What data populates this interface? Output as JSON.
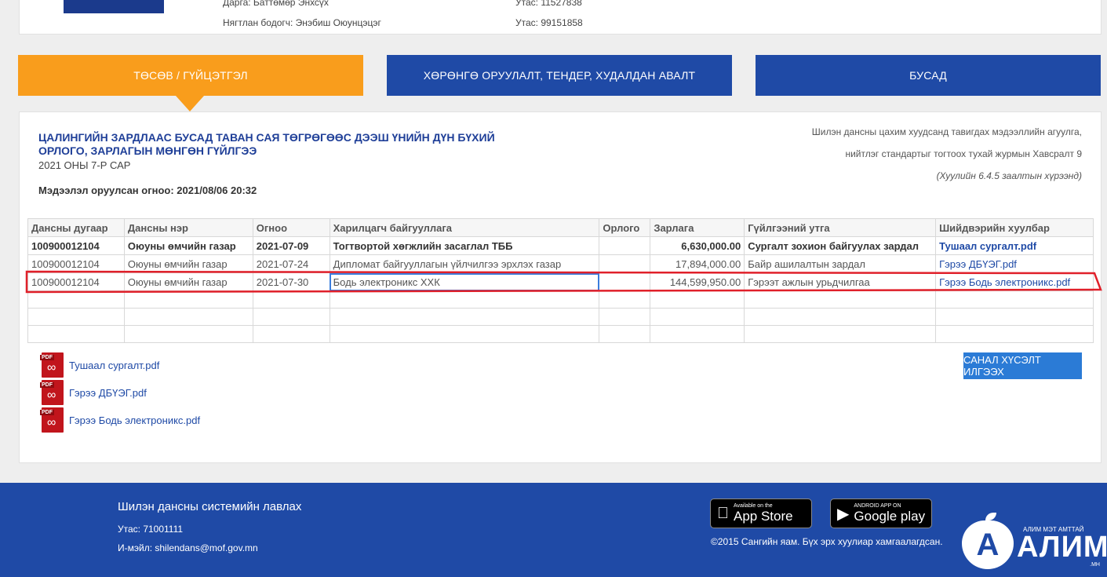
{
  "top_info": {
    "director": "Дарга: Баттөмөр Энхсүх",
    "director_phone": "Утас: 11527838",
    "accountant": "Нягтлан бодогч: Энэбиш Оюунцэцэг",
    "accountant_phone": "Утас: 99151858"
  },
  "tabs": [
    {
      "label": "ТӨСӨВ / ГҮЙЦЭТГЭЛ"
    },
    {
      "label": "ХӨРӨНГӨ ОРУУЛАЛТ, ТЕНДЕР, ХУДАЛДАН АВАЛТ"
    },
    {
      "label": "БУСАД"
    }
  ],
  "panel": {
    "title": "ЦАЛИНГИЙН ЗАРДЛААС БУСАД ТАВАН САЯ ТӨГРӨГӨӨС ДЭЭШ ҮНИЙН ДҮН БҮХИЙ ОРЛОГО, ЗАРЛАГЫН МӨНГӨН ГҮЙЛГЭЭ",
    "period": "2021 ОНЫ 7-Р САР",
    "updated": "Мэдээлэл оруулсан огноо: 2021/08/06 20:32",
    "note_line1": "Шилэн дансны цахим хуудсанд тавигдах мэдээллийн агуулга,",
    "note_line2": "нийтлэг стандартыг тогтоох тухай журмын Хавсралт 9",
    "note_line3": "(Хуулийн 6.4.5 заалтын хүрээнд)"
  },
  "table": {
    "headers": [
      "Дансны дугаар",
      "Дансны нэр",
      "Огноо",
      "Харилцагч байгууллага",
      "Орлого",
      "Зарлага",
      "Гүйлгээний утга",
      "Шийдвэрийн хуулбар"
    ],
    "rows": [
      {
        "account": "100900012104",
        "name": "Оюуны өмчийн газар",
        "date": "2021-07-09",
        "partner": "Тогтвортой хөгжлийн засаглал ТББ",
        "income": "",
        "expense": "6,630,000.00",
        "purpose": "Сургалт зохион байгуулах зардал",
        "file": "Тушаал сургалт.pdf"
      },
      {
        "account": "100900012104",
        "name": "Оюуны өмчийн газар",
        "date": "2021-07-24",
        "partner": "Дипломат байгууллагын үйлчилгээ эрхлэх газар",
        "income": "",
        "expense": "17,894,000.00",
        "purpose": "Байр ашилалтын зардал",
        "file": "Гэрээ ДБҮЭГ.pdf"
      },
      {
        "account": "100900012104",
        "name": "Оюуны өмчийн газар",
        "date": "2021-07-30",
        "partner": "Бодь электроникс ХХК",
        "income": "",
        "expense": "144,599,950.00",
        "purpose": "Гэрээт ажлын урьдчилгаа",
        "file": "Гэрээ Бодь электроникс.pdf"
      }
    ]
  },
  "files": [
    {
      "label": "Тушаал сургалт.pdf"
    },
    {
      "label": "Гэрээ ДБҮЭГ.pdf"
    },
    {
      "label": "Гэрээ Бодь электроникс.pdf"
    }
  ],
  "pdf_tag": "PDF",
  "send_button": "САНАЛ ХҮСЭЛТ ИЛГЭЭХ",
  "footer": {
    "title": "Шилэн дансны системийн лавлах",
    "phone": "Утас: 71001111",
    "email": "И-мэйл: shilendans@mof.gov.mn",
    "appstore_small": "Available on the",
    "appstore_big": "App Store",
    "googleplay_small": "ANDROID APP ON",
    "googleplay_big": "Google play",
    "copyright": "©2015 Сангийн яам. Бүх эрх хуулиар хамгаалагдсан.",
    "brand_tagline": "АЛИМ МЭТ АМТТАЙ",
    "brand_name": "АЛИМ",
    "brand_domain": ".МН",
    "brand_letter": "А"
  },
  "colors": {
    "active_tab": "#f99d1c",
    "blue": "#1f4aa6",
    "annotation": "#e0202a"
  }
}
